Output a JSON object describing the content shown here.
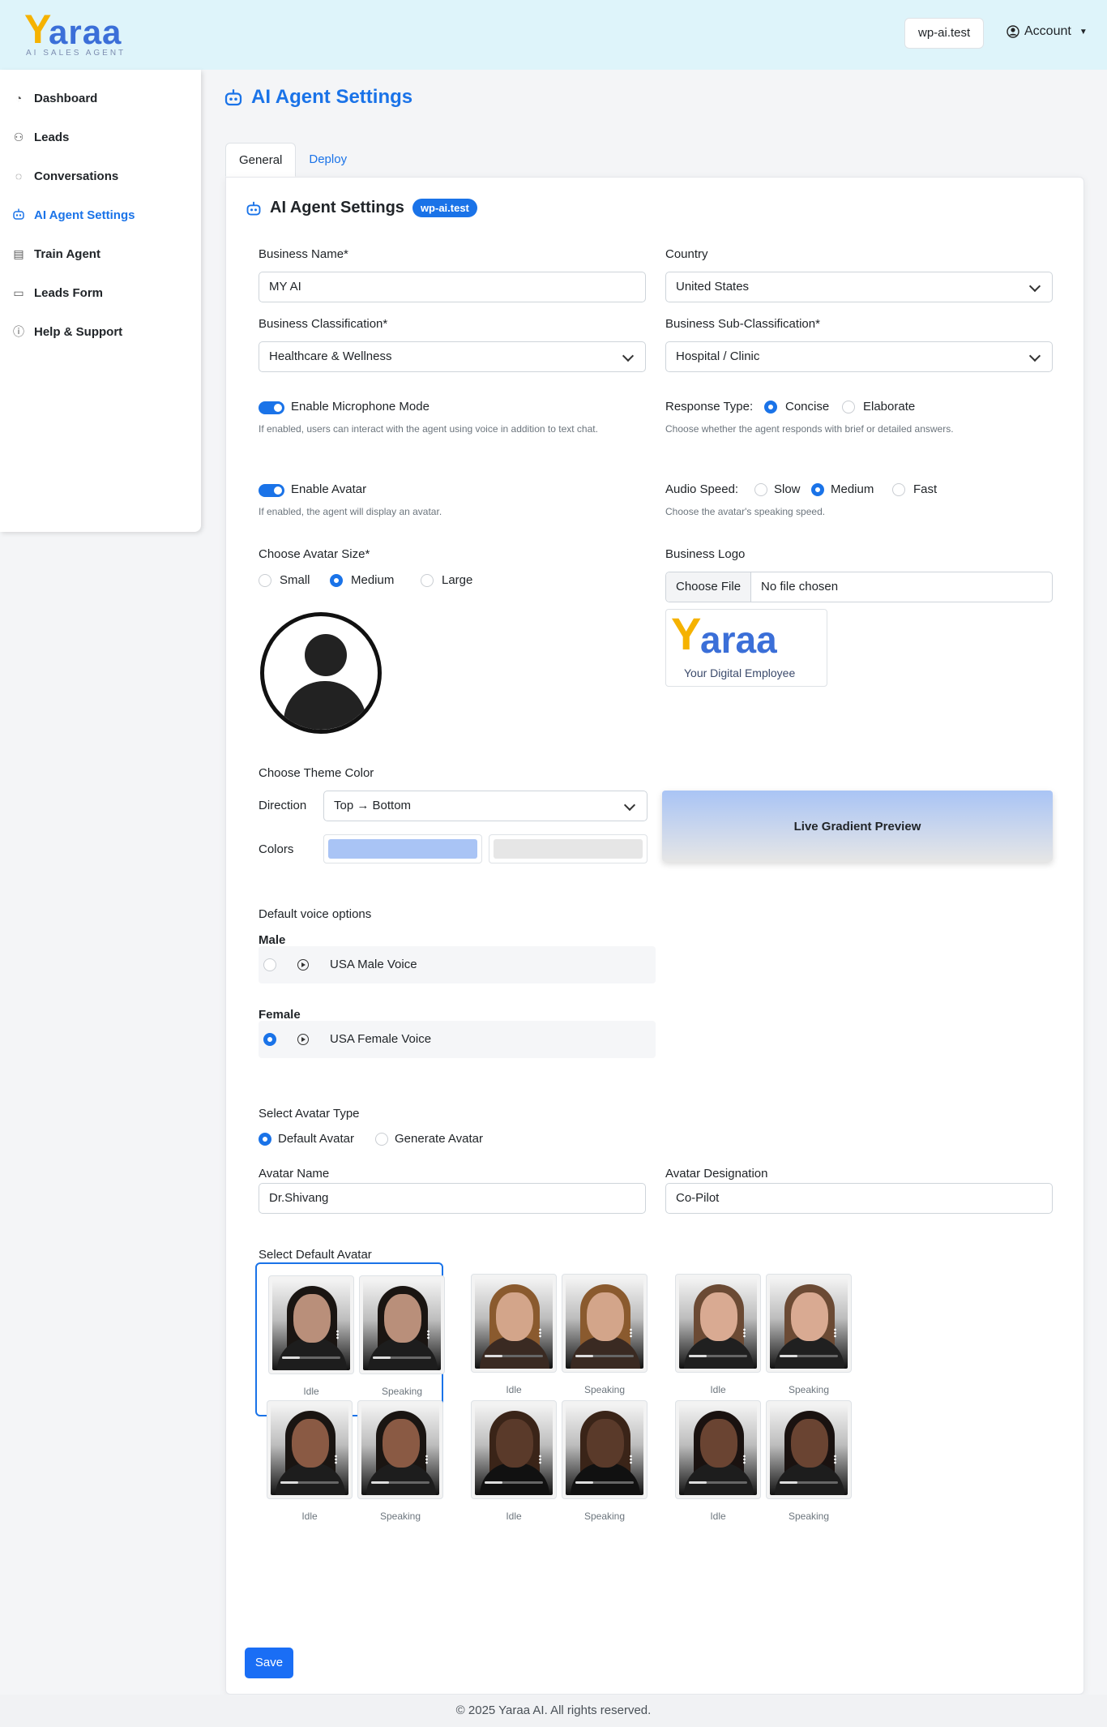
{
  "brand": {
    "logo_y": "Y",
    "logo_rest": "araa",
    "tagline": "AI SALES AGENT"
  },
  "header": {
    "site_button": "wp-ai.test",
    "account_label": "Account"
  },
  "sidebar": {
    "items": [
      {
        "label": "Dashboard",
        "icon": "dashboard-icon"
      },
      {
        "label": "Leads",
        "icon": "users-icon"
      },
      {
        "label": "Conversations",
        "icon": "chat-icon"
      },
      {
        "label": "AI Agent Settings",
        "icon": "robot-icon",
        "active": true
      },
      {
        "label": "Train Agent",
        "icon": "clipboard-icon"
      },
      {
        "label": "Leads Form",
        "icon": "form-icon"
      },
      {
        "label": "Help & Support",
        "icon": "help-icon"
      }
    ]
  },
  "page": {
    "title": "AI Agent Settings"
  },
  "tabs": [
    {
      "label": "General",
      "active": true
    },
    {
      "label": "Deploy",
      "active": false
    }
  ],
  "card": {
    "title": "AI Agent Settings",
    "badge": "wp-ai.test"
  },
  "form": {
    "business_name": {
      "label": "Business Name*",
      "value": "MY AI"
    },
    "country": {
      "label": "Country",
      "value": "United States"
    },
    "classification": {
      "label": "Business Classification*",
      "value": "Healthcare & Wellness"
    },
    "sub_classification": {
      "label": "Business Sub-Classification*",
      "value": "Hospital / Clinic"
    },
    "microphone": {
      "label": "Enable Microphone Mode",
      "enabled": true,
      "help": "If enabled, users can interact with the agent using voice in addition to text chat."
    },
    "response_type": {
      "label": "Response Type:",
      "options": [
        "Concise",
        "Elaborate"
      ],
      "selected": "Concise",
      "help": "Choose whether the agent responds with brief or detailed answers."
    },
    "avatar_toggle": {
      "label": "Enable Avatar",
      "enabled": true,
      "help": "If enabled, the agent will display an avatar."
    },
    "audio_speed": {
      "label": "Audio Speed:",
      "options": [
        "Slow",
        "Medium",
        "Fast"
      ],
      "selected": "Medium",
      "help": "Choose the avatar's speaking speed."
    },
    "avatar_size": {
      "label": "Choose Avatar Size*",
      "options": [
        "Small",
        "Medium",
        "Large"
      ],
      "selected": "Medium"
    },
    "business_logo": {
      "label": "Business Logo",
      "button": "Choose File",
      "file_name": "No file chosen",
      "preview_y": "Y",
      "preview_rest": "araa",
      "preview_tagline": "Your Digital Employee"
    },
    "theme": {
      "label": "Choose Theme Color",
      "direction_label": "Direction",
      "direction_value": "Top → Bottom",
      "colors_label": "Colors",
      "color1": "#a9c4f5",
      "color2": "#e6e6e6",
      "preview_label": "Live Gradient Preview"
    },
    "voice": {
      "label": "Default voice options",
      "male_heading": "Male",
      "male_option": "USA Male Voice",
      "female_heading": "Female",
      "female_option": "USA Female Voice",
      "selected": "USA Female Voice"
    },
    "avatar_type": {
      "label": "Select Avatar Type",
      "options": [
        "Default Avatar",
        "Generate Avatar"
      ],
      "selected": "Default Avatar"
    },
    "avatar_name": {
      "label": "Avatar Name",
      "value": "Dr.Shivang"
    },
    "avatar_designation": {
      "label": "Avatar Designation",
      "value": "Co-Pilot"
    },
    "default_avatar": {
      "label": "Select Default Avatar",
      "idle_label": "Idle",
      "speaking_label": "Speaking",
      "selected_index": 0
    },
    "save_label": "Save"
  },
  "footer": {
    "text": "© 2025 Yaraa AI. All rights reserved."
  }
}
